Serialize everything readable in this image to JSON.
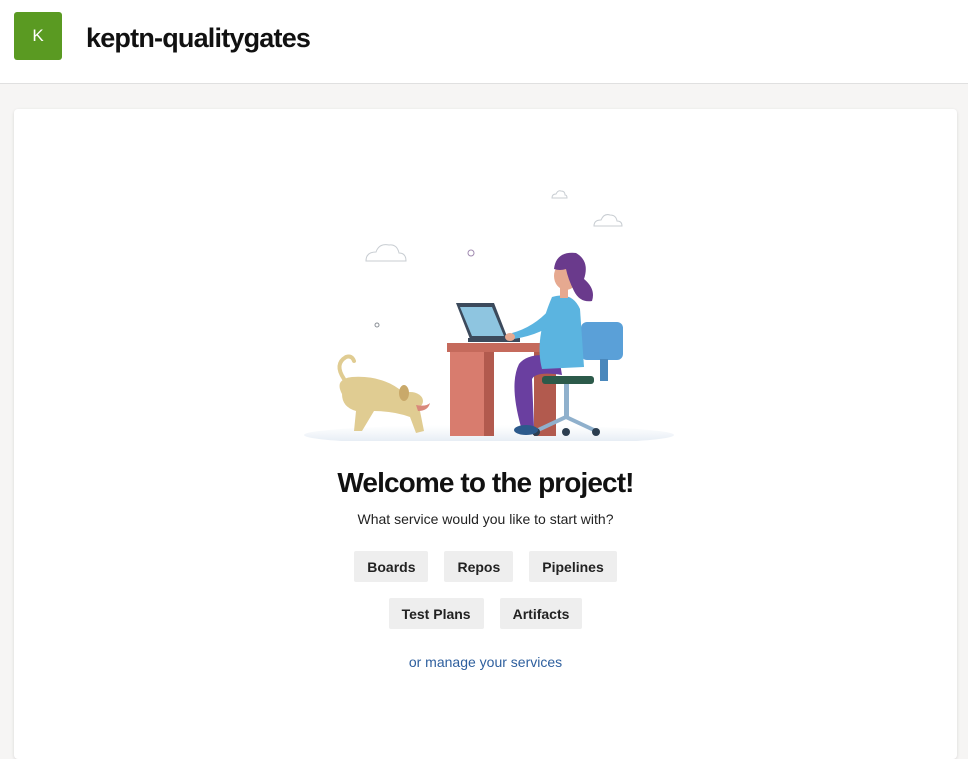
{
  "header": {
    "avatar_letter": "K",
    "project_name": "keptn-qualitygates"
  },
  "welcome": {
    "title": "Welcome to the project!",
    "subtitle": "What service would you like to start with?"
  },
  "services": [
    {
      "label": "Boards"
    },
    {
      "label": "Repos"
    },
    {
      "label": "Pipelines"
    },
    {
      "label": "Test Plans"
    },
    {
      "label": "Artifacts"
    }
  ],
  "manage_link": "or manage your services",
  "colors": {
    "avatar_bg": "#5a9a22",
    "link": "#2e5f9e",
    "button_bg": "#eeeeee"
  }
}
